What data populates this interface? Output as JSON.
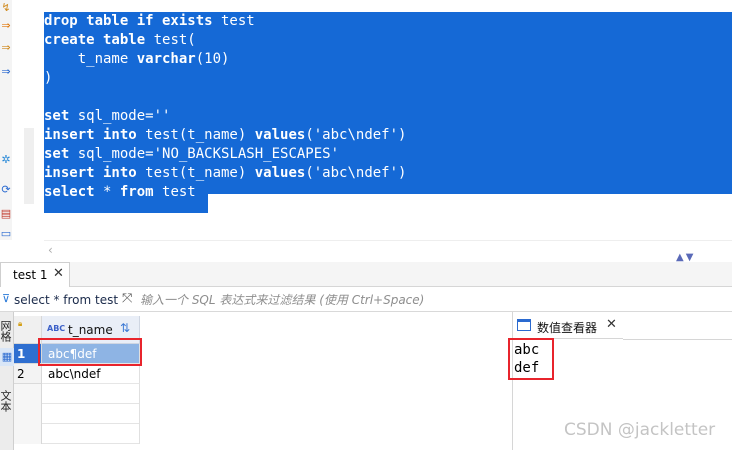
{
  "editor": {
    "lines": [
      [
        {
          "t": "drop table if exists",
          "kw": true
        },
        {
          "t": " test",
          "kw": false
        }
      ],
      [
        {
          "t": "create table",
          "kw": true
        },
        {
          "t": " test(",
          "kw": false
        }
      ],
      [
        {
          "t": "    t_name ",
          "kw": false
        },
        {
          "t": "varchar",
          "kw": true
        },
        {
          "t": "(10)",
          "kw": false
        }
      ],
      [
        {
          "t": ")",
          "kw": false
        }
      ],
      [],
      [
        {
          "t": "set",
          "kw": true
        },
        {
          "t": " sql_mode=''",
          "kw": false
        }
      ],
      [
        {
          "t": "insert into",
          "kw": true
        },
        {
          "t": " test(t_name) ",
          "kw": false
        },
        {
          "t": "values",
          "kw": true
        },
        {
          "t": "('abc\\ndef')",
          "kw": false
        }
      ],
      [
        {
          "t": "set",
          "kw": true
        },
        {
          "t": " sql_mode='NO_BACKSLASH_ESCAPES'",
          "kw": false
        }
      ],
      [
        {
          "t": "insert into",
          "kw": true
        },
        {
          "t": " test(t_name) ",
          "kw": false
        },
        {
          "t": "values",
          "kw": true
        },
        {
          "t": "('abc\\ndef')",
          "kw": false
        }
      ],
      [
        {
          "t": "select",
          "kw": true
        },
        {
          "t": " * ",
          "kw": false
        },
        {
          "t": "from",
          "kw": true
        },
        {
          "t": " test",
          "kw": false
        }
      ]
    ]
  },
  "tabs": {
    "result_tab_label": "test 1",
    "close_glyph": "✕"
  },
  "filter": {
    "query": "select * from test",
    "placeholder": "输入一个 SQL 表达式来过滤结果 (使用 Ctrl+Space)"
  },
  "side_panel": {
    "tab1_label": "网格",
    "tab2_label": "文本"
  },
  "grid": {
    "column_type_label": "ABC",
    "column_name": "t_name",
    "rows": [
      {
        "num": "1",
        "value": "abc¶def"
      },
      {
        "num": "2",
        "value": "abc\\ndef"
      }
    ]
  },
  "value_viewer": {
    "title": "数值查看器",
    "close_glyph": "✕",
    "content": "abc\ndef"
  },
  "watermark": "CSDN @jackletter",
  "colors": {
    "selection": "#1569d6",
    "highlight_box": "#e8242c",
    "active_row": "#2f6fd0"
  }
}
